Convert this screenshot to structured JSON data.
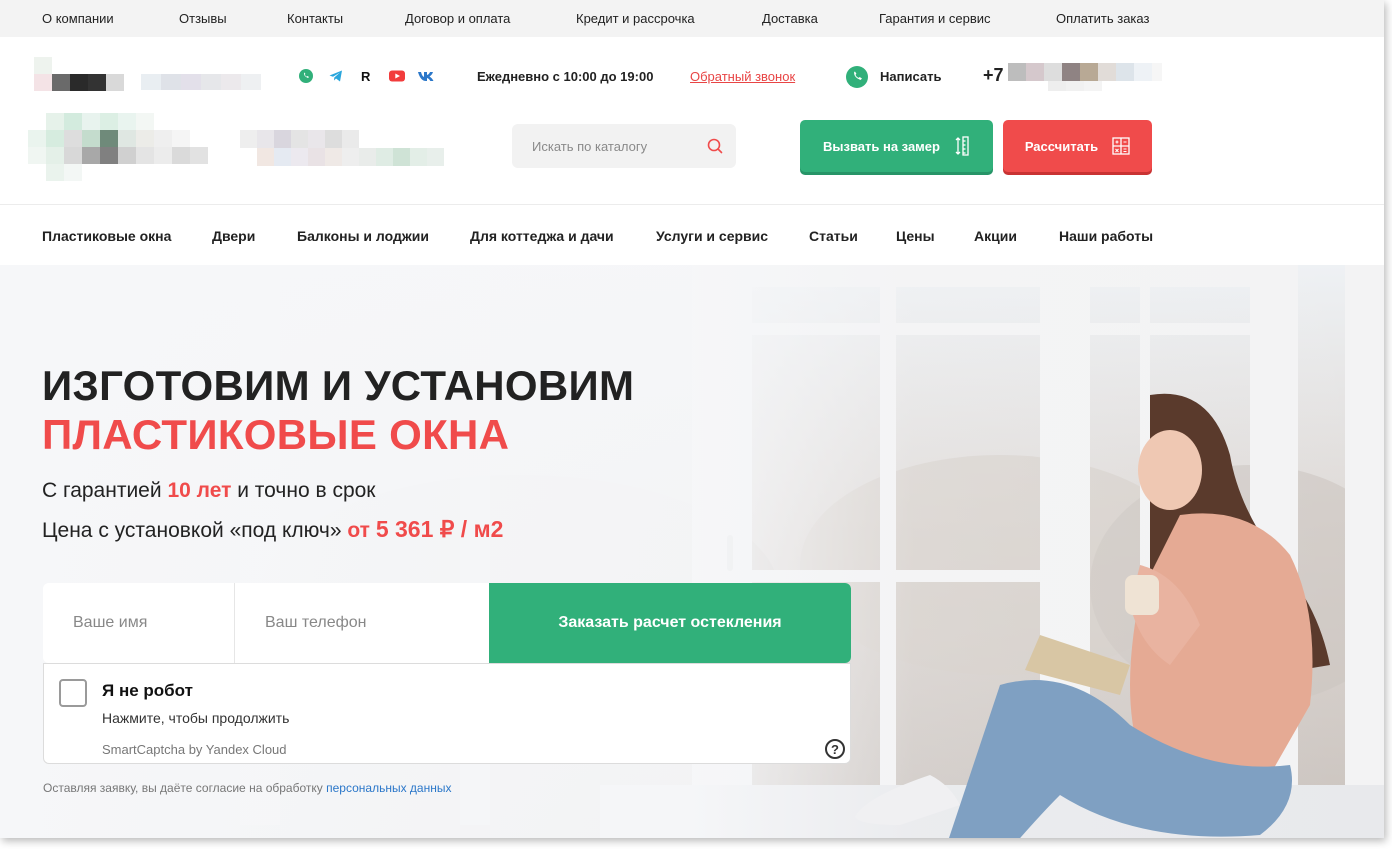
{
  "top_links": [
    "О компании",
    "Отзывы",
    "Контакты",
    "Договор и оплата",
    "Кредит и рассрочка",
    "Доставка",
    "Гарантия и сервис",
    "Оплатить заказ"
  ],
  "header": {
    "social_icons": [
      "whatsapp-icon",
      "telegram-icon",
      "rutube-icon",
      "youtube-icon",
      "vk-icon"
    ],
    "hours": "Ежедневно с 10:00 до 19:00",
    "callback": "Обратный звонок",
    "write": "Написать",
    "phone_prefix": "+7",
    "search_placeholder": "Искать по каталогу",
    "measure_button": "Вызвать на замер",
    "calc_button": "Рассчитать"
  },
  "nav": [
    "Пластиковые окна",
    "Двери",
    "Балконы и лоджии",
    "Для коттеджа и дачи",
    "Услуги и сервис",
    "Статьи",
    "Цены",
    "Акции",
    "Наши работы"
  ],
  "hero": {
    "title_line1": "ИЗГОТОВИМ И УСТАНОВИМ",
    "title_line2": "ПЛАСТИКОВЫЕ ОКНА",
    "guarantee_prefix": "С гарантией",
    "guarantee_value": "10 лет",
    "guarantee_suffix": "и точно в срок",
    "price_prefix": "Цена с установкой «под ключ»",
    "price_from": "от",
    "price_value": "5 361 ₽ / м2"
  },
  "form": {
    "name_placeholder": "Ваше имя",
    "phone_placeholder": "Ваш телефон",
    "submit": "Заказать расчет остекления"
  },
  "captcha": {
    "title": "Я не робот",
    "subtitle": "Нажмите, чтобы продолжить",
    "brand": "SmartCaptcha by Yandex Cloud",
    "help": "?"
  },
  "consent": {
    "text": "Оставляя заявку, вы даёте согласие на обработку",
    "link": "персональных данных"
  },
  "colors": {
    "accent_green": "#31b07a",
    "accent_red": "#f04b4b",
    "link_blue": "#2b77c9"
  }
}
